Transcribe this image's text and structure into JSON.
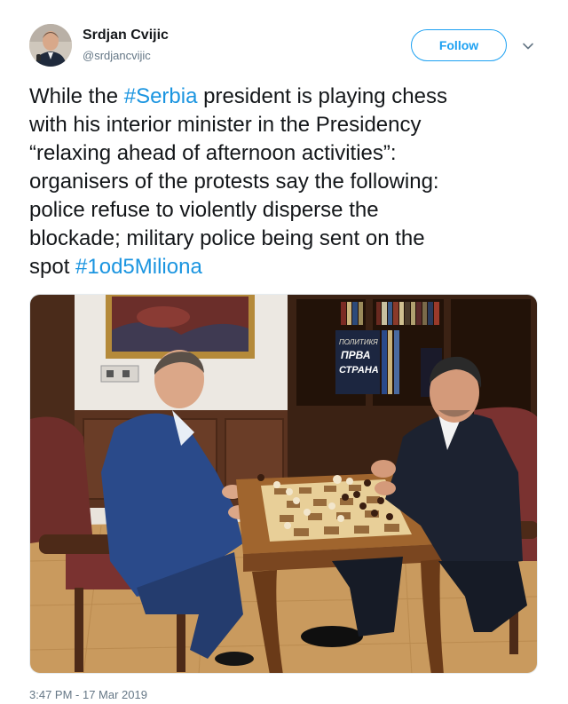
{
  "author": {
    "name": "Srdjan Cvijic",
    "handle": "@srdjancvijic"
  },
  "follow_label": "Follow",
  "icons": {
    "caret": "chevron-down-icon",
    "avatar": "avatar"
  },
  "tweet": {
    "segments": [
      {
        "text": "While the ",
        "hashtag": false
      },
      {
        "text": "#Serbia",
        "hashtag": true
      },
      {
        "text": " president is playing chess",
        "hashtag": false
      },
      {
        "text": "with his interior minister in the Presidency",
        "hashtag": false
      },
      {
        "text": "“relaxing ahead of afternoon activities”:",
        "hashtag": false
      },
      {
        "text": "organisers of the protests say the following:",
        "hashtag": false
      },
      {
        "text": "police refuse to violently disperse the",
        "hashtag": false
      },
      {
        "text": "blockade; military police being sent on the",
        "hashtag": false
      },
      {
        "text": "spot ",
        "hashtag": false
      },
      {
        "text": "#1od5Miliona",
        "hashtag": true
      }
    ]
  },
  "photo": {
    "book_cover_lines": [
      "ПОЛИТИКЯ",
      "ПРВА",
      "СТРАНА"
    ]
  },
  "timestamp": "3:47 PM - 17 Mar 2019",
  "colors": {
    "link": "#1b95e0",
    "follow": "#1da1f2",
    "secondary": "#657786"
  }
}
